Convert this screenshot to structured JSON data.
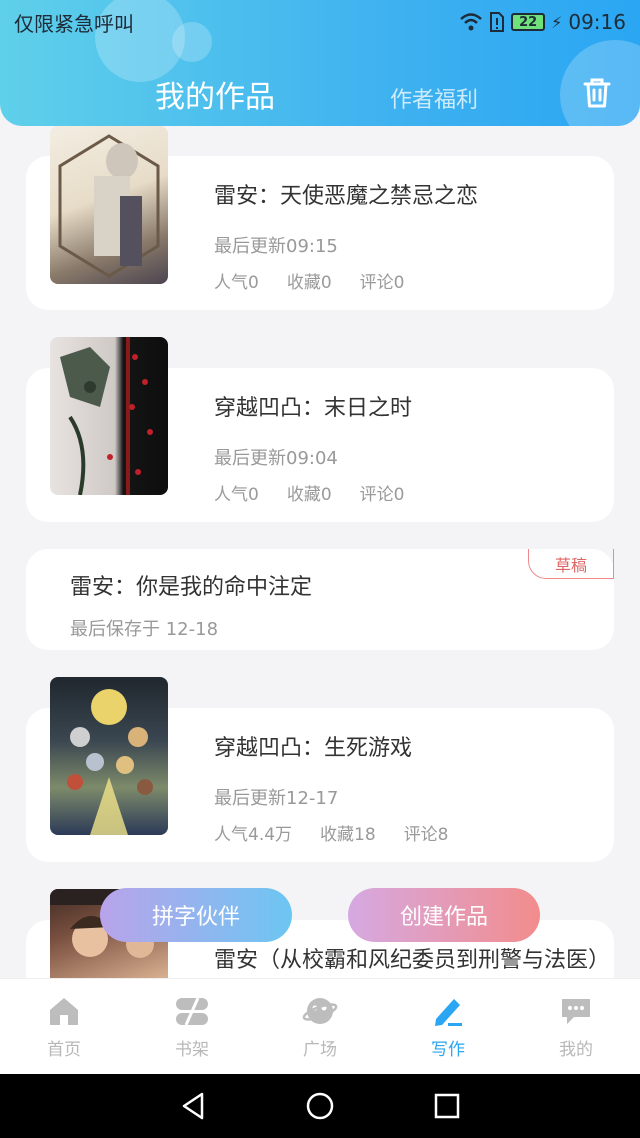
{
  "status_bar": {
    "carrier": "仅限紧急呼叫",
    "battery": "22",
    "time": "09:16"
  },
  "header": {
    "tabs": [
      {
        "label": "我的作品",
        "active": true
      },
      {
        "label": "作者福利",
        "active": false
      }
    ],
    "trash_icon": "trash-icon"
  },
  "works": [
    {
      "title": "雷安：天使恶魔之禁忌之恋",
      "updated": "最后更新09:15",
      "stats": [
        "人气0",
        "收藏0",
        "评论0"
      ]
    },
    {
      "title": "穿越凹凸：末日之时",
      "updated": "最后更新09:04",
      "stats": [
        "人气0",
        "收藏0",
        "评论0"
      ]
    },
    {
      "title": "雷安：你是我的命中注定",
      "updated": "最后保存于 12-18",
      "badge": "草稿"
    },
    {
      "title": "穿越凹凸：生死游戏",
      "updated": "最后更新12-17",
      "stats": [
        "人气4.4万",
        "收藏18",
        "评论8"
      ]
    },
    {
      "title": "雷安（从校霸和风纪委员到刑警与法医）"
    }
  ],
  "fab": {
    "partner": "拼字伙伴",
    "create": "创建作品"
  },
  "bottom_nav": [
    {
      "label": "首页",
      "icon": "home-icon"
    },
    {
      "label": "书架",
      "icon": "bookshelf-icon"
    },
    {
      "label": "广场",
      "icon": "planet-icon"
    },
    {
      "label": "写作",
      "icon": "pen-icon",
      "active": true
    },
    {
      "label": "我的",
      "icon": "chat-bubble-icon"
    }
  ],
  "colors": {
    "accent": "#2aa6f2",
    "draft": "#e06666"
  }
}
